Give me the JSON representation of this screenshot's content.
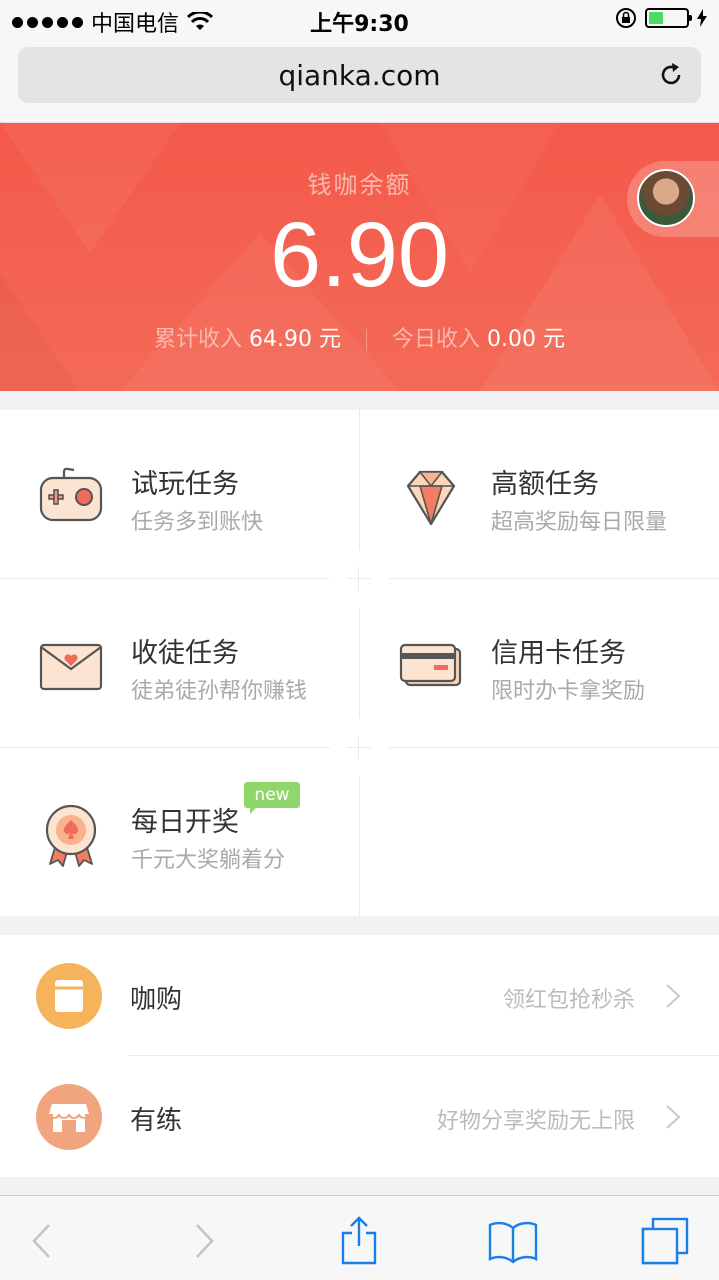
{
  "status_bar": {
    "carrier": "中国电信",
    "time": "上午9:30"
  },
  "browser": {
    "url": "qianka.com"
  },
  "balance": {
    "title": "钱咖余额",
    "amount": "6.90",
    "total_label": "累计收入",
    "total_value": "64.90 元",
    "today_label": "今日收入",
    "today_value": "0.00 元"
  },
  "tasks": [
    {
      "title": "试玩任务",
      "subtitle": "任务多到账快",
      "icon": "gamepad-icon"
    },
    {
      "title": "高额任务",
      "subtitle": "超高奖励每日限量",
      "icon": "diamond-icon"
    },
    {
      "title": "收徒任务",
      "subtitle": "徒弟徒孙帮你赚钱",
      "icon": "envelope-heart-icon"
    },
    {
      "title": "信用卡任务",
      "subtitle": "限时办卡拿奖励",
      "icon": "credit-card-icon"
    },
    {
      "title": "每日开奖",
      "subtitle": "千元大奖躺着分",
      "icon": "award-medal-icon",
      "badge": "new"
    }
  ],
  "links": [
    {
      "title": "咖购",
      "hint": "领红包抢秒杀",
      "icon": "shopping-bag-icon",
      "color": "#f7b35b"
    },
    {
      "title": "有练",
      "hint": "好物分享奖励无上限",
      "icon": "shop-icon",
      "color": "#f0a57f"
    }
  ],
  "colors": {
    "hero_red": "#f4594a",
    "badge_green": "#8fd66b",
    "ios_blue": "#1a7fe6"
  }
}
